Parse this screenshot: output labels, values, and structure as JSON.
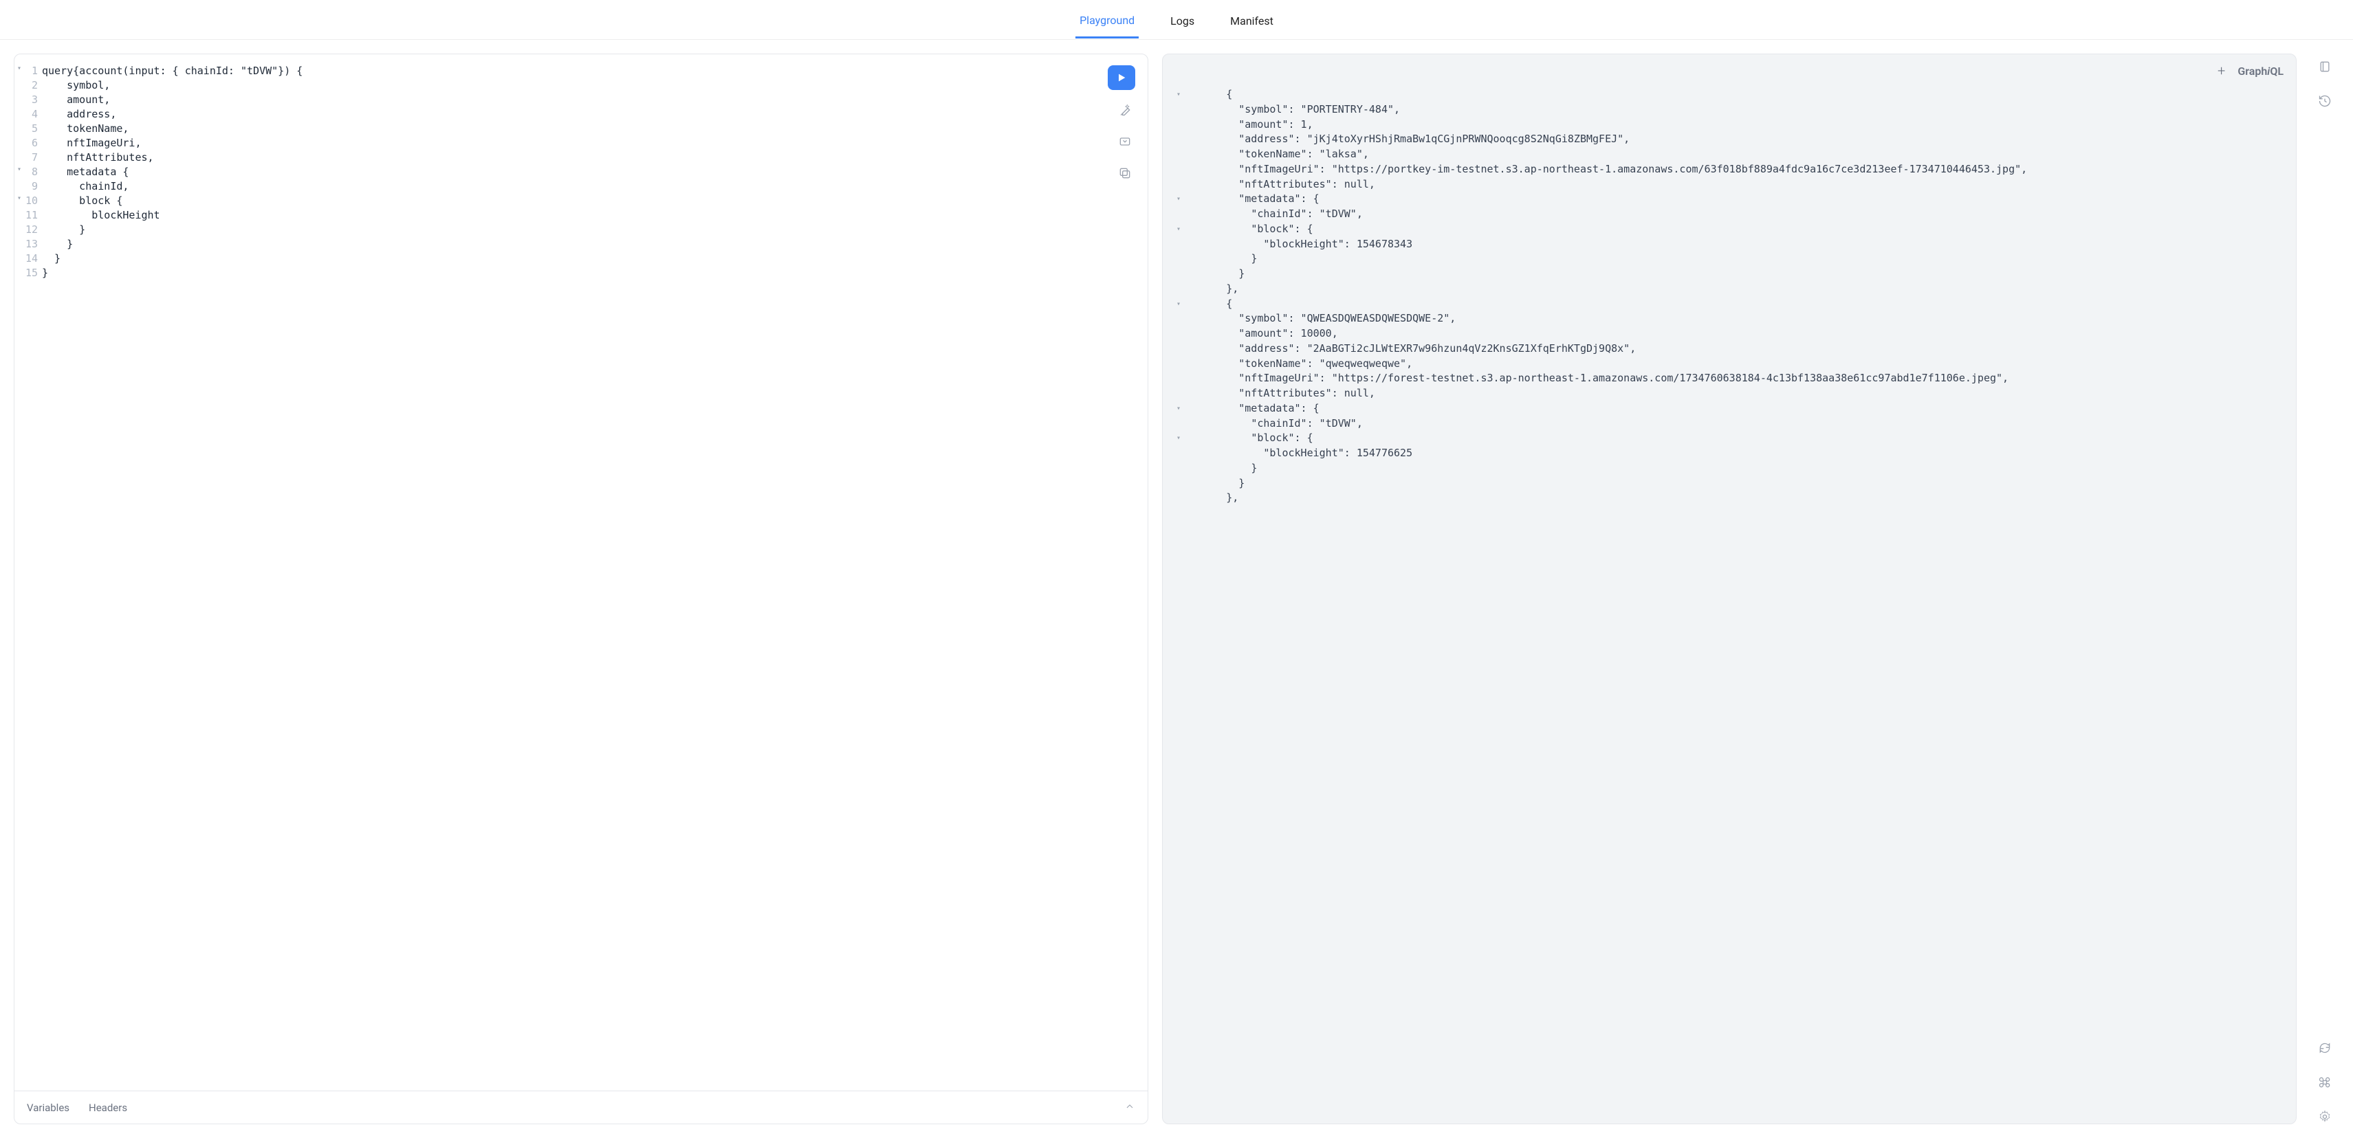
{
  "tabs": {
    "playground": "Playground",
    "logs": "Logs",
    "manifest": "Manifest",
    "active": "playground"
  },
  "editor": {
    "lines": [
      "query{account(input: { chainId: \"tDVW\"}) {",
      "    symbol,",
      "    amount,",
      "    address,",
      "    tokenName,",
      "    nftImageUri,",
      "    nftAttributes,",
      "    metadata {",
      "      chainId,",
      "      block {",
      "        blockHeight",
      "      }",
      "    }",
      "  }",
      "}"
    ],
    "fold_lines": [
      1,
      8,
      10
    ]
  },
  "footer": {
    "variables": "Variables",
    "headers": "Headers"
  },
  "result_header": {
    "brand_left": "Graph",
    "brand_i": "i",
    "brand_right": "QL"
  },
  "result_lines": [
    {
      "t": "      {",
      "fold": true
    },
    {
      "t": "        \"symbol\": \"PORTENTRY-484\","
    },
    {
      "t": "        \"amount\": 1,"
    },
    {
      "t": "        \"address\": \"jKj4toXyrHShjRmaBw1qCGjnPRWNQooqcg8S2NqGi8ZBMgFEJ\","
    },
    {
      "t": "        \"tokenName\": \"laksa\","
    },
    {
      "t": "        \"nftImageUri\": \"https://portkey-im-testnet.s3.ap-northeast-1.amazonaws.com/63f018bf889a4fdc9a16c7ce3d213eef-1734710446453.jpg\","
    },
    {
      "t": "        \"nftAttributes\": null,"
    },
    {
      "t": "        \"metadata\": {",
      "fold": true
    },
    {
      "t": "          \"chainId\": \"tDVW\","
    },
    {
      "t": "          \"block\": {",
      "fold": true
    },
    {
      "t": "            \"blockHeight\": 154678343"
    },
    {
      "t": "          }"
    },
    {
      "t": "        }"
    },
    {
      "t": "      },"
    },
    {
      "t": "      {",
      "fold": true
    },
    {
      "t": "        \"symbol\": \"QWEASDQWEASDQWESDQWE-2\","
    },
    {
      "t": "        \"amount\": 10000,"
    },
    {
      "t": "        \"address\": \"2AaBGTi2cJLWtEXR7w96hzun4qVz2KnsGZ1XfqErhKTgDj9Q8x\","
    },
    {
      "t": "        \"tokenName\": \"qweqweqweqwe\","
    },
    {
      "t": "        \"nftImageUri\": \"https://forest-testnet.s3.ap-northeast-1.amazonaws.com/1734760638184-4c13bf138aa38e61cc97abd1e7f1106e.jpeg\","
    },
    {
      "t": "        \"nftAttributes\": null,"
    },
    {
      "t": "        \"metadata\": {",
      "fold": true
    },
    {
      "t": "          \"chainId\": \"tDVW\","
    },
    {
      "t": "          \"block\": {",
      "fold": true
    },
    {
      "t": "            \"blockHeight\": 154776625"
    },
    {
      "t": "          }"
    },
    {
      "t": "        }"
    },
    {
      "t": "      },"
    }
  ]
}
